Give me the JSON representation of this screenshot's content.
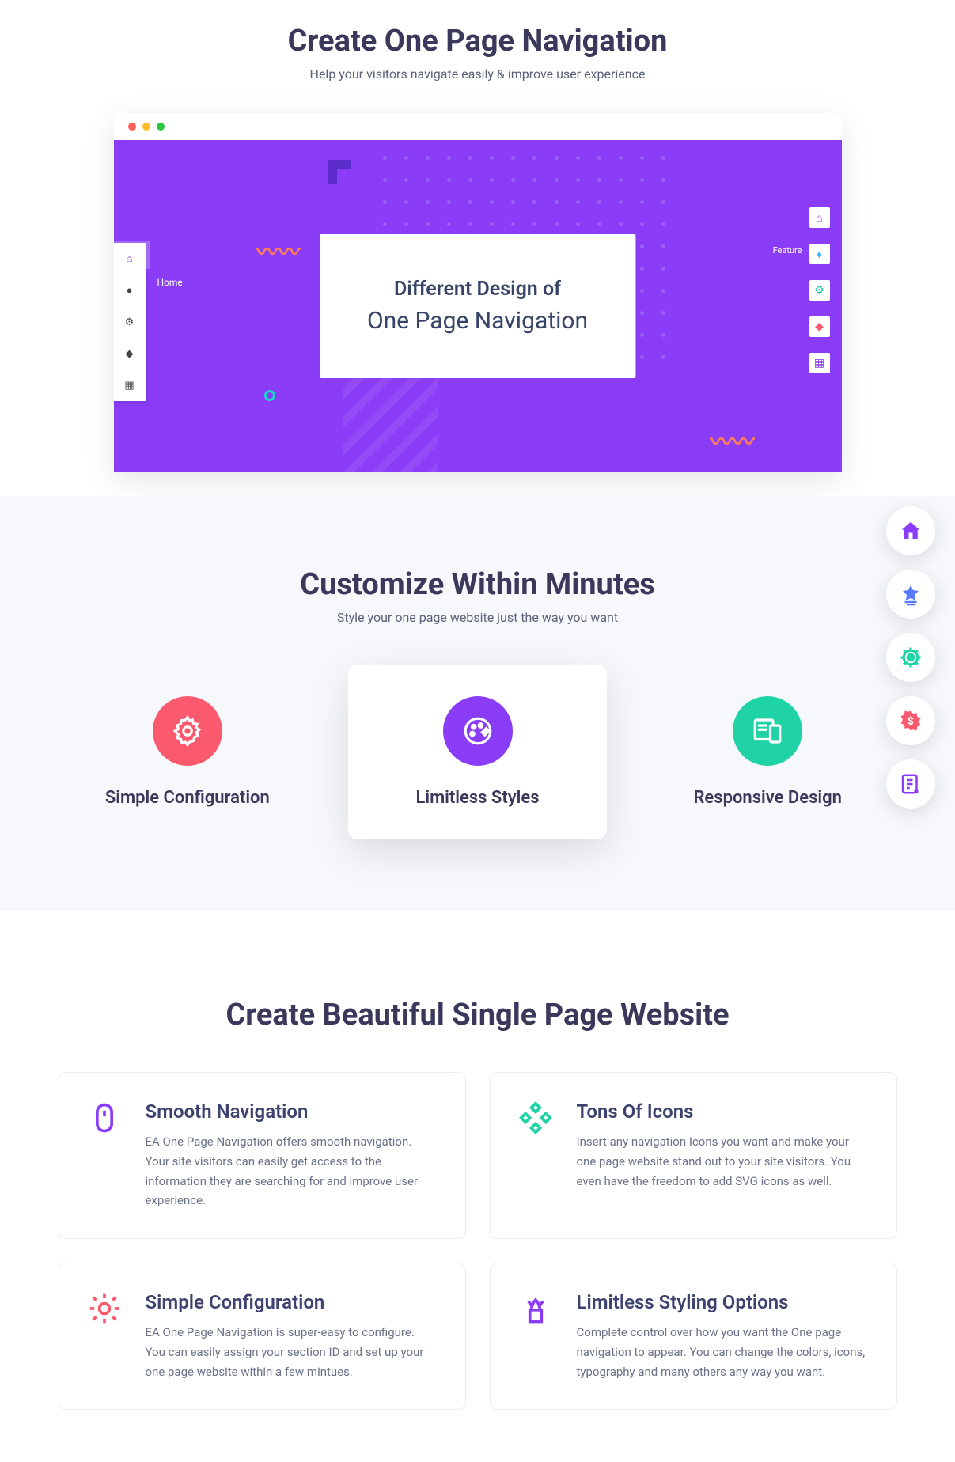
{
  "section1": {
    "title": "Create One Page Navigation",
    "subtitle": "Help your visitors navigate easily & improve user experience",
    "hero_line1": "Different Design of",
    "hero_line2": "One Page Navigation",
    "left_nav_label": "Home",
    "right_nav_label": "Feature"
  },
  "section2": {
    "title": "Customize Within Minutes",
    "subtitle": "Style your one page website just the way you want",
    "cards": [
      {
        "title": "Simple Configuration",
        "icon": "gear",
        "color": "#fb5a6e"
      },
      {
        "title": "Limitless Styles",
        "icon": "palette",
        "color": "#8a3cf7"
      },
      {
        "title": "Responsive Design",
        "icon": "devices",
        "color": "#1fd3a6"
      }
    ]
  },
  "section3": {
    "title": "Create Beautiful Single Page Website",
    "cards": [
      {
        "title": "Smooth Navigation",
        "desc": "EA One Page Navigation offers smooth navigation. Your site visitors can easily get access to the information they are searching for and improve user experience.",
        "icon": "mouse",
        "color": "#8a3cf7"
      },
      {
        "title": "Tons Of Icons",
        "desc": "Insert any navigation Icons you want and make your one page website stand out to your site visitors. You even have the freedom to add SVG icons as well.",
        "icon": "diamonds",
        "color": "#1fd3a6"
      },
      {
        "title": "Simple Configuration",
        "desc": "EA One Page Navigation is super-easy to configure. You can easily assign your section ID and set up your one page website within a few mintues.",
        "icon": "gear",
        "color": "#fb5a6e"
      },
      {
        "title": "Limitless Styling Options",
        "desc": "Complete control over how you want the One page navigation to appear. You can change the colors, icons, typography and many others any way you want.",
        "icon": "plant",
        "color": "#8a3cf7"
      }
    ]
  },
  "fixed_nav": {
    "items": [
      {
        "icon": "home",
        "color": "#8a3cf7"
      },
      {
        "icon": "star-lines",
        "color": "#5b7bff"
      },
      {
        "icon": "gear-ring",
        "color": "#1fd3a6"
      },
      {
        "icon": "badge-dollar",
        "color": "#fb5a6e"
      },
      {
        "icon": "note-pen",
        "color": "#8a3cf7"
      }
    ]
  }
}
